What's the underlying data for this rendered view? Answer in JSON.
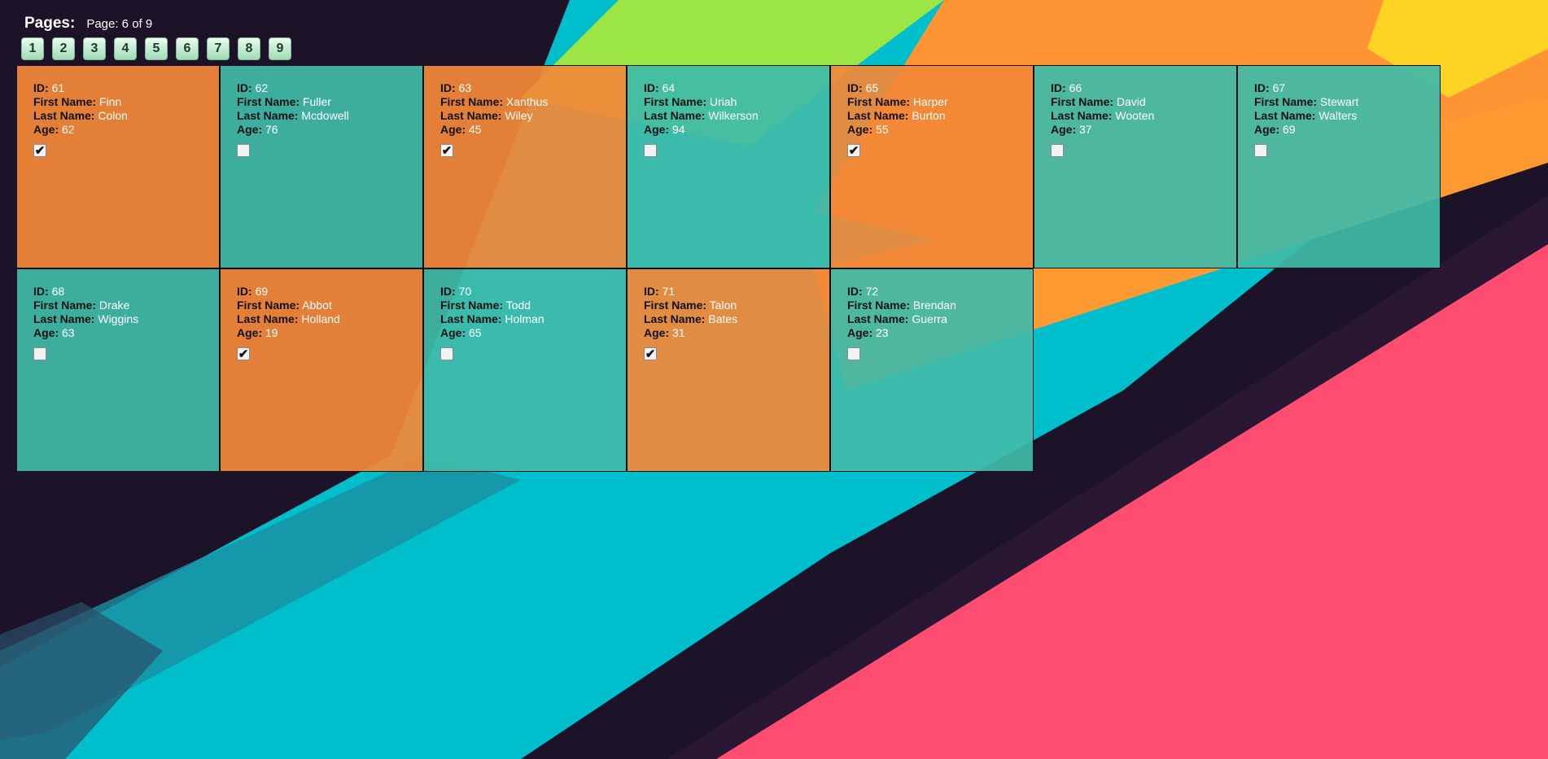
{
  "pager": {
    "title": "Pages:",
    "status": "Page: 6 of 9",
    "buttons": [
      "1",
      "2",
      "3",
      "4",
      "5",
      "6",
      "7",
      "8",
      "9"
    ]
  },
  "labels": {
    "id": "ID:",
    "first": "First Name:",
    "last": "Last Name:",
    "age": "Age:"
  },
  "colors": {
    "orange": "#f28838",
    "teal": "#40baa8",
    "pink": "#ff4d71",
    "cyan": "#00c4d2",
    "dark": "#1d1328"
  },
  "records": [
    {
      "id": "61",
      "first": "Finn",
      "last": "Colon",
      "age": "62",
      "checked": true,
      "color": "orange"
    },
    {
      "id": "62",
      "first": "Fuller",
      "last": "Mcdowell",
      "age": "76",
      "checked": false,
      "color": "teal"
    },
    {
      "id": "63",
      "first": "Xanthus",
      "last": "Wiley",
      "age": "45",
      "checked": true,
      "color": "orange"
    },
    {
      "id": "64",
      "first": "Uriah",
      "last": "Wilkerson",
      "age": "94",
      "checked": false,
      "color": "teal"
    },
    {
      "id": "65",
      "first": "Harper",
      "last": "Burton",
      "age": "55",
      "checked": true,
      "color": "orange"
    },
    {
      "id": "66",
      "first": "David",
      "last": "Wooten",
      "age": "37",
      "checked": false,
      "color": "teal"
    },
    {
      "id": "67",
      "first": "Stewart",
      "last": "Walters",
      "age": "69",
      "checked": false,
      "color": "teal"
    },
    {
      "id": "68",
      "first": "Drake",
      "last": "Wiggins",
      "age": "63",
      "checked": false,
      "color": "teal"
    },
    {
      "id": "69",
      "first": "Abbot",
      "last": "Holland",
      "age": "19",
      "checked": true,
      "color": "orange"
    },
    {
      "id": "70",
      "first": "Todd",
      "last": "Holman",
      "age": "65",
      "checked": false,
      "color": "teal"
    },
    {
      "id": "71",
      "first": "Talon",
      "last": "Bates",
      "age": "31",
      "checked": true,
      "color": "orange"
    },
    {
      "id": "72",
      "first": "Brendan",
      "last": "Guerra",
      "age": "23",
      "checked": false,
      "color": "teal"
    }
  ]
}
